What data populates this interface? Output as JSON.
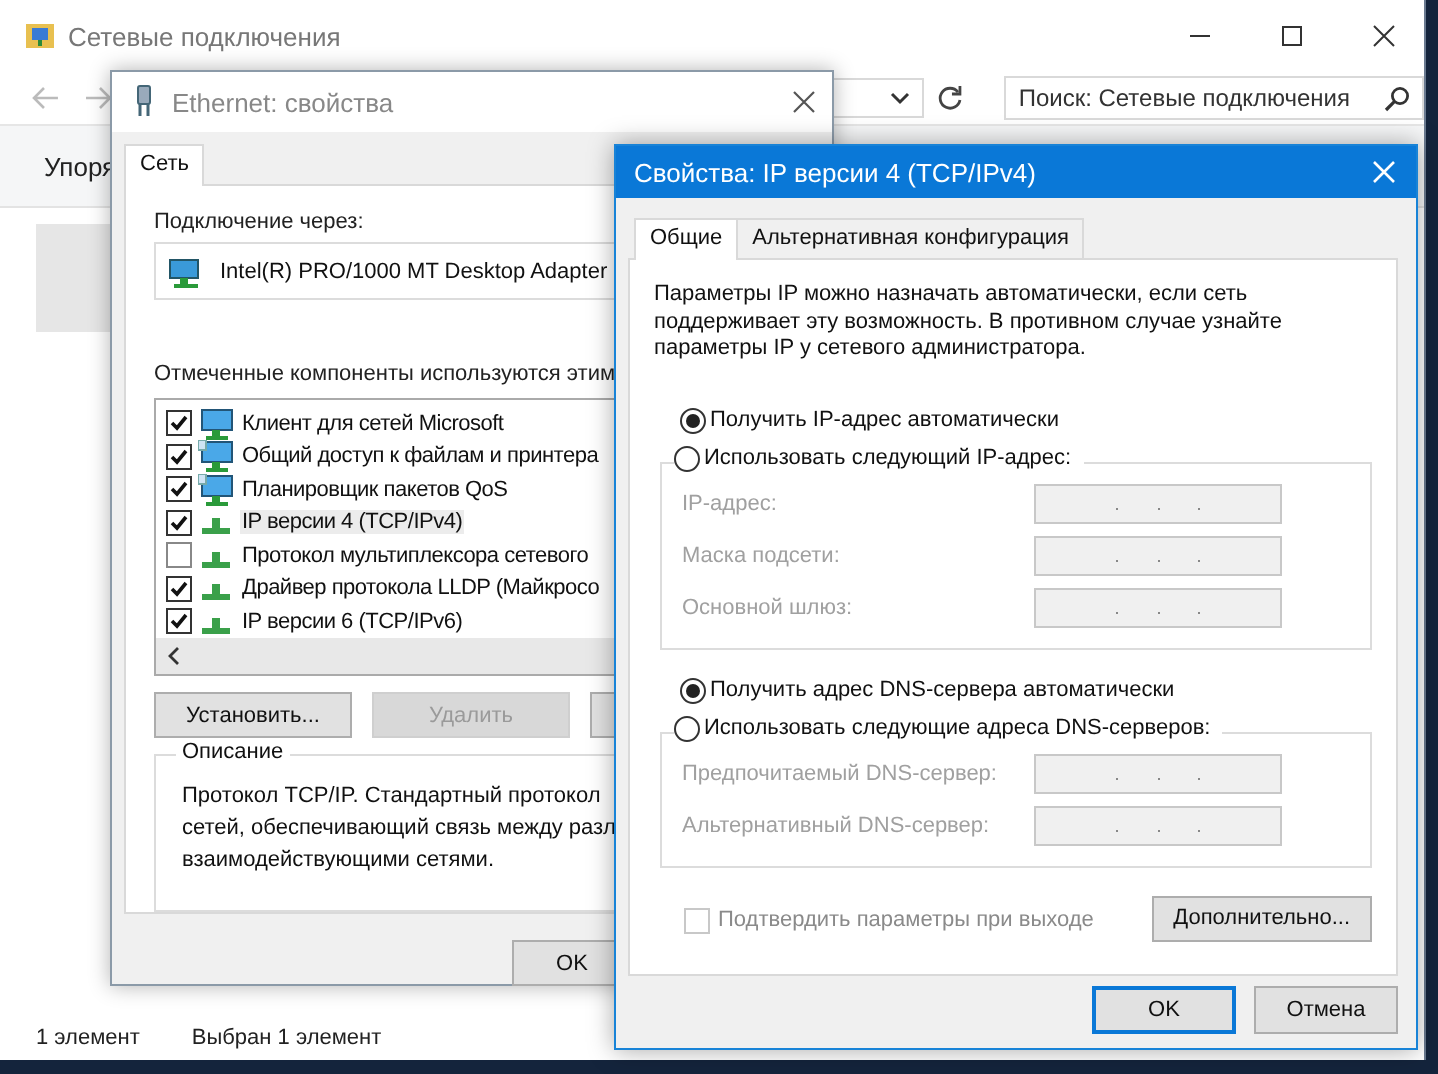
{
  "explorer": {
    "title": "Сетевые подключения",
    "search": {
      "placeholder": "Поиск: Сетевые подключения"
    },
    "ribbon_tab": "Упоря",
    "status_bar": [
      "1 элемент",
      "Выбран 1 элемент"
    ]
  },
  "ethernet_dialog": {
    "title": "Ethernet: свойства",
    "tabs": [
      {
        "label": "Сеть",
        "selected": true
      }
    ],
    "connect_using_label": "Подключение через:",
    "adapter": "Intel(R) PRO/1000 MT Desktop Adapter",
    "components_label": "Отмеченные компоненты используются этим",
    "components": [
      {
        "name": "Клиент для сетей Microsoft",
        "checked": true,
        "kind": "client",
        "selected": false
      },
      {
        "name": "Общий доступ к файлам и принтера",
        "checked": true,
        "kind": "service",
        "selected": false
      },
      {
        "name": "Планировщик пакетов QoS",
        "checked": true,
        "kind": "service",
        "selected": false
      },
      {
        "name": "IP версии 4 (TCP/IPv4)",
        "checked": true,
        "kind": "protocol",
        "selected": true
      },
      {
        "name": "Протокол мультиплексора сетевого",
        "checked": false,
        "kind": "protocol",
        "selected": false
      },
      {
        "name": "Драйвер протокола LLDP (Майкросо",
        "checked": true,
        "kind": "protocol",
        "selected": false
      },
      {
        "name": "IP версии 6 (TCP/IPv6)",
        "checked": true,
        "kind": "protocol",
        "selected": false
      }
    ],
    "buttons": [
      {
        "label": "Установить...",
        "disabled": false
      },
      {
        "label": "Удалить",
        "disabled": true
      },
      {
        "disabled": false
      }
    ],
    "description": {
      "title": "Описание",
      "lines": [
        "Протокол TCP/IP. Стандартный протокол",
        "сетей, обеспечивающий связь между разл",
        "взаимодействующими сетями."
      ]
    },
    "footer_buttons": [
      {
        "label": "OK"
      }
    ]
  },
  "ipv4_dialog": {
    "title": "Свойства: IP версии 4 (TCP/IPv4)",
    "tabs": [
      {
        "label": "Общие",
        "selected": true
      },
      {
        "label": "Альтернативная конфигурация",
        "selected": false
      }
    ],
    "intro": [
      "Параметры IP можно назначать автоматически, если сеть",
      "поддерживает эту возможность. В противном случае узнайте",
      "параметры IP у сетевого администратора."
    ],
    "ip_mode": [
      {
        "label": "Получить IP-адрес автоматически",
        "selected": true
      },
      {
        "label": "Использовать следующий IP-адрес:",
        "selected": false
      }
    ],
    "ip_fields": [
      {
        "label": "IP-адрес:",
        "disabled": true
      },
      {
        "label": "Маска подсети:",
        "disabled": true
      },
      {
        "label": "Основной шлюз:",
        "disabled": true
      }
    ],
    "dns_mode": [
      {
        "label": "Получить адрес DNS-сервера автоматически",
        "selected": true
      },
      {
        "label": "Использовать следующие адреса DNS-серверов:",
        "selected": false
      }
    ],
    "dns_fields": [
      {
        "label": "Предпочитаемый DNS-сервер:",
        "disabled": true
      },
      {
        "label": "Альтернативный DNS-сервер:",
        "disabled": true
      }
    ],
    "validate": {
      "label": "Подтвердить параметры при выходе",
      "checked": false,
      "disabled": true
    },
    "advanced_button": "Дополнительно...",
    "footer_buttons": [
      {
        "label": "OK",
        "default": true
      },
      {
        "label": "Отмена",
        "default": false
      }
    ]
  }
}
